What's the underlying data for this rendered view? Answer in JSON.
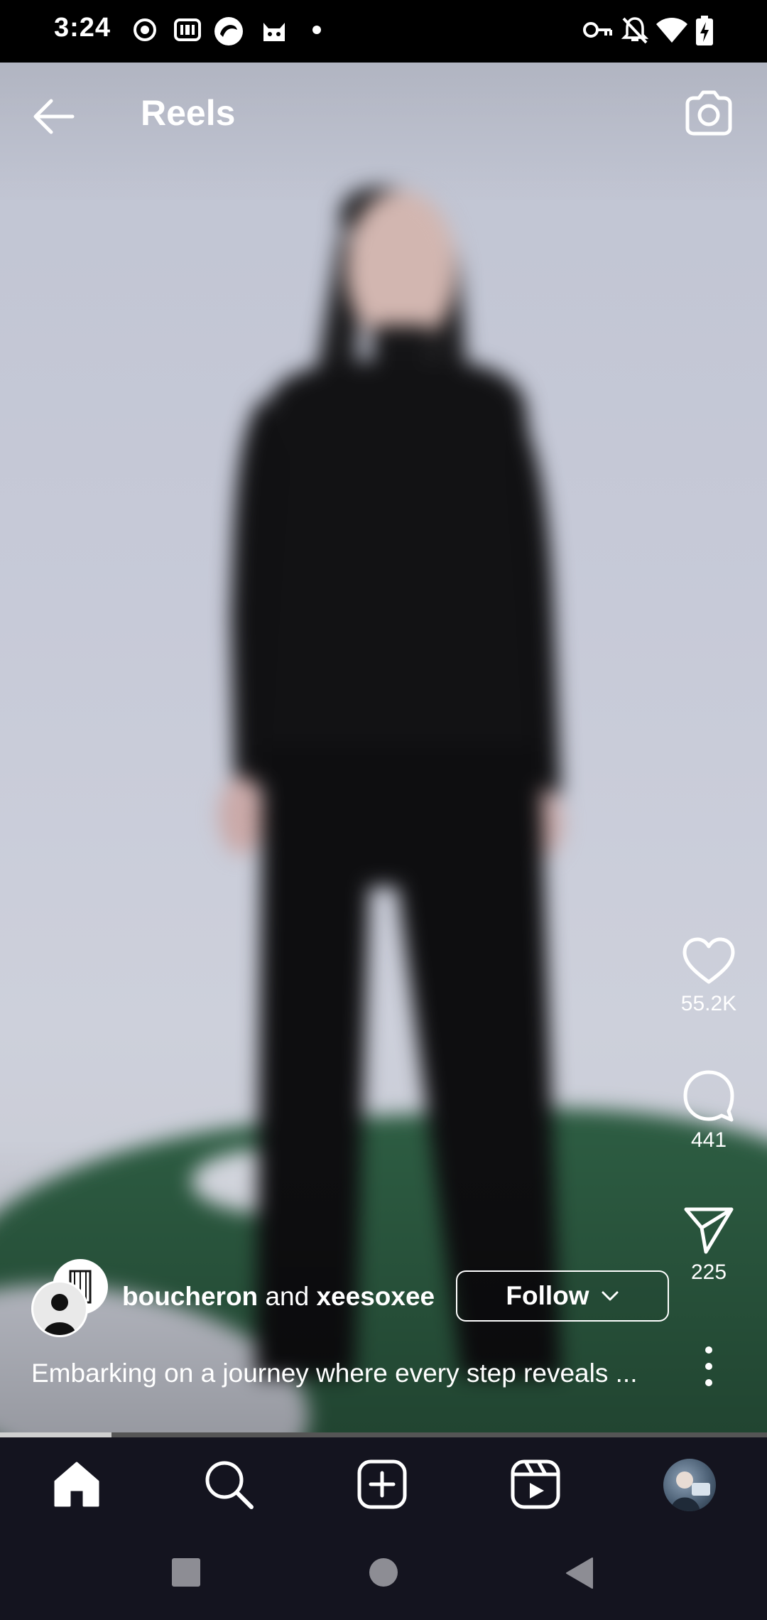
{
  "status_bar": {
    "time": "3:24",
    "left_icons": [
      "record-icon",
      "iqiyi-icon",
      "browser-icon",
      "cat-app-icon",
      "dot-icon"
    ],
    "right_icons": [
      "vpn-key-icon",
      "bell-off-icon",
      "wifi-icon",
      "battery-charging-icon"
    ]
  },
  "header": {
    "title": "Reels",
    "back_icon": "arrow-left-icon",
    "camera_icon": "camera-icon"
  },
  "actions": {
    "likes": "55.2K",
    "comments": "441",
    "shares": "225"
  },
  "post": {
    "author_primary": "boucheron",
    "author_connector": "and",
    "author_secondary": "xeesoxee",
    "follow_label": "Follow",
    "caption": "Embarking on a journey where every step reveals ..."
  },
  "video": {
    "progress_fraction": 0.145
  },
  "bottom_nav": {
    "items": [
      "home-icon",
      "search-icon",
      "create-icon",
      "reels-icon",
      "profile-avatar"
    ],
    "active": "home-icon"
  },
  "system_nav": [
    "recents-button",
    "home-button",
    "back-button"
  ],
  "colors": {
    "nav_background": "#14141f",
    "text": "#ffffff"
  }
}
